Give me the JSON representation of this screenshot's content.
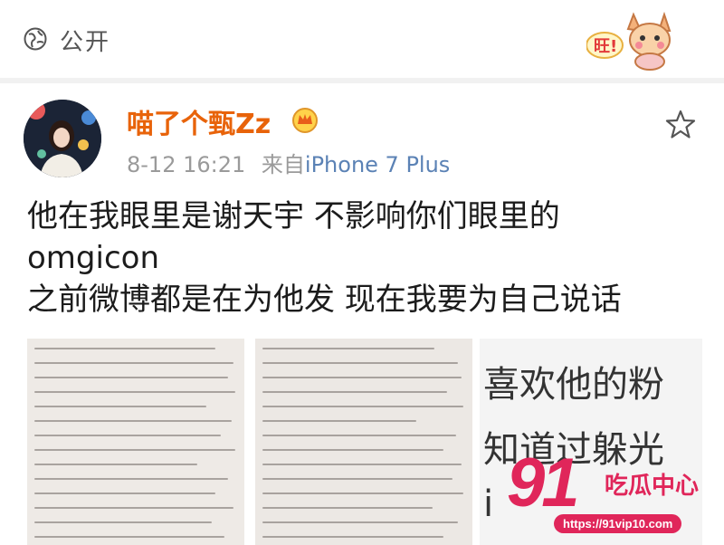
{
  "header": {
    "privacy_label": "公开",
    "sticker_text": "旺!"
  },
  "post": {
    "author": "喵了个甄Zz",
    "timestamp": "8-12 16:21",
    "source_prefix": "来自",
    "source_device": "iPhone 7 Plus",
    "text_lines": [
      "他在我眼里是谢天宇 不影响你们眼里的",
      "omgicon",
      "之前微博都是在为他发 现在我要为自己说话"
    ]
  },
  "images": {
    "third_image_lines": [
      "喜欢他的粉",
      "知道过躲光",
      "i"
    ]
  },
  "watermark": {
    "number": "91",
    "name": "吃瓜中心",
    "url": "https://91vip10.com"
  },
  "colors": {
    "author": "#e8630a",
    "source": "#5b82b5",
    "watermark": "#e0265a"
  }
}
